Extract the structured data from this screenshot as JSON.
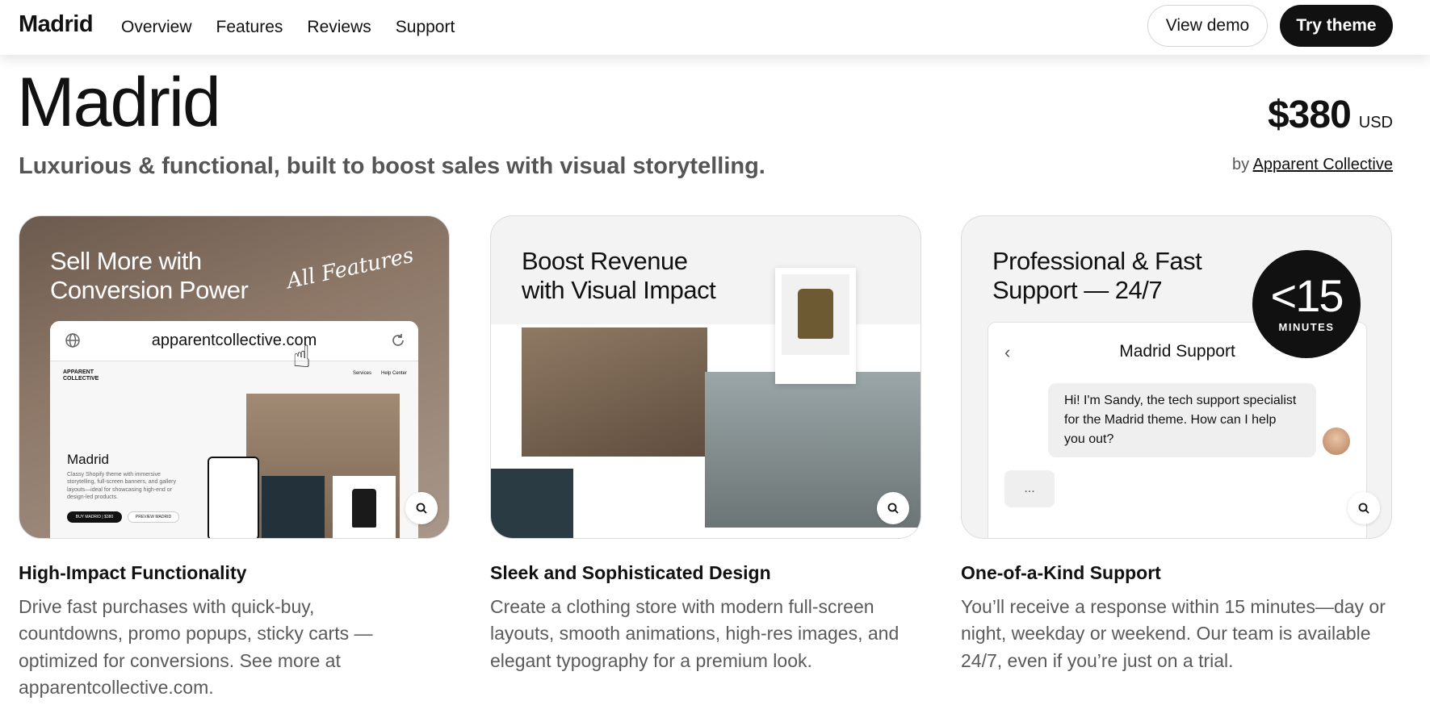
{
  "header": {
    "brand": "Madrid",
    "nav": [
      "Overview",
      "Features",
      "Reviews",
      "Support"
    ],
    "view_demo": "View demo",
    "try_theme": "Try theme"
  },
  "hero": {
    "title": "Madrid",
    "subtitle": "Luxurious & functional, built to boost sales with visual storytelling.",
    "price": "$380",
    "currency": "USD",
    "by": "by",
    "author": "Apparent Collective"
  },
  "cards": [
    {
      "heading": "Sell More with Conversion Power",
      "note": "All Features",
      "browser": {
        "url": "apparentcollective.com",
        "logo": "APPARENT COLLECTIVE",
        "nav": [
          "Services",
          "Help Center"
        ],
        "title": "Madrid",
        "desc": "Classy Shopify theme with immersive storytelling, full-screen banners, and gallery layouts—ideal for showcasing high-end or design-led products.",
        "buy": "BUY MADRID | $380",
        "preview": "PREVIEW MADRID"
      },
      "title": "High-Impact Functionality",
      "body": "Drive fast purchases with quick-buy, countdowns, promo popups, sticky carts — optimized for conversions. See more at apparentcollective.com."
    },
    {
      "heading": "Boost Revenue with Visual Impact",
      "title": "Sleek and Sophisticated Design",
      "body": "Create a clothing store with modern full-screen layouts, smooth animations, high-res images, and elegant typography for a premium look."
    },
    {
      "heading": "Professional & Fast Support — 24/7",
      "badge_num": "<15",
      "badge_label": "MINUTES",
      "chat": {
        "title": "Madrid Support",
        "message": "Hi! I'm Sandy, the tech support specialist for the Madrid theme. How can I help you out?",
        "typing": "..."
      },
      "title": "One-of-a-Kind Support",
      "body": "You’ll receive a response within 15 minutes—day or night, weekday or weekend. Our team is available 24/7, even if you’re just on a trial."
    }
  ]
}
